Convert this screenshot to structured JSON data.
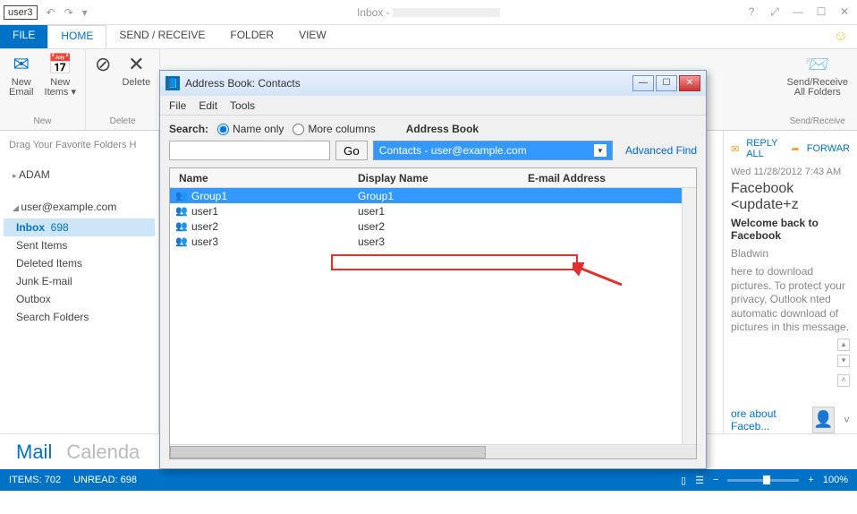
{
  "titlebar": {
    "user": "user3",
    "inbox_label": "Inbox -"
  },
  "tabs": {
    "file": "FILE",
    "home": "HOME",
    "send_receive": "SEND / RECEIVE",
    "folder": "FOLDER",
    "view": "VIEW"
  },
  "ribbon": {
    "new_email": "New\nEmail",
    "new_items": "New\nItems ▾",
    "delete": "Delete",
    "group_new": "New",
    "group_delete": "Delete",
    "send_receive": "Send/Receive\nAll Folders",
    "group_sr": "Send/Receive"
  },
  "sidebar": {
    "drag_hint": "Drag Your Favorite Folders H",
    "accounts": [
      {
        "label": "ADAM",
        "open": false
      },
      {
        "label": "user@example.com",
        "open": true
      }
    ],
    "folders": [
      {
        "label": "Inbox",
        "count": "698",
        "selected": true
      },
      {
        "label": "Sent Items"
      },
      {
        "label": "Deleted Items"
      },
      {
        "label": "Junk E-mail"
      },
      {
        "label": "Outbox"
      },
      {
        "label": "Search Folders"
      }
    ]
  },
  "reading": {
    "reply_all": "REPLY ALL",
    "forward": "FORWAR",
    "date": "Wed 11/28/2012 7:43 AM",
    "from": "Facebook <update+z",
    "subject": "Welcome back to Facebook",
    "to": "Bladwin",
    "info": "here to download pictures. To protect your privacy, Outlook nted automatic download of pictures in this message.",
    "more": "ore about Faceb..."
  },
  "nav": {
    "mail": "Mail",
    "calendar": "Calenda"
  },
  "status": {
    "items": "ITEMS: 702",
    "unread": "UNREAD: 698",
    "zoom": "100%"
  },
  "dialog": {
    "title": "Address Book: Contacts",
    "menu": {
      "file": "File",
      "edit": "Edit",
      "tools": "Tools"
    },
    "search_label": "Search:",
    "name_only": "Name only",
    "more_cols": "More columns",
    "ab_label": "Address Book",
    "go": "Go",
    "ab_selected": "Contacts - user@example.com",
    "advanced": "Advanced Find",
    "columns": {
      "name": "Name",
      "display": "Display Name",
      "email": "E-mail Address"
    },
    "rows": [
      {
        "icon": "group",
        "name": "Group1",
        "display": "Group1",
        "selected": true
      },
      {
        "icon": "person",
        "name": "user1",
        "display": "user1"
      },
      {
        "icon": "person",
        "name": "user2",
        "display": "user2"
      },
      {
        "icon": "person",
        "name": "user3",
        "display": "user3"
      }
    ]
  }
}
